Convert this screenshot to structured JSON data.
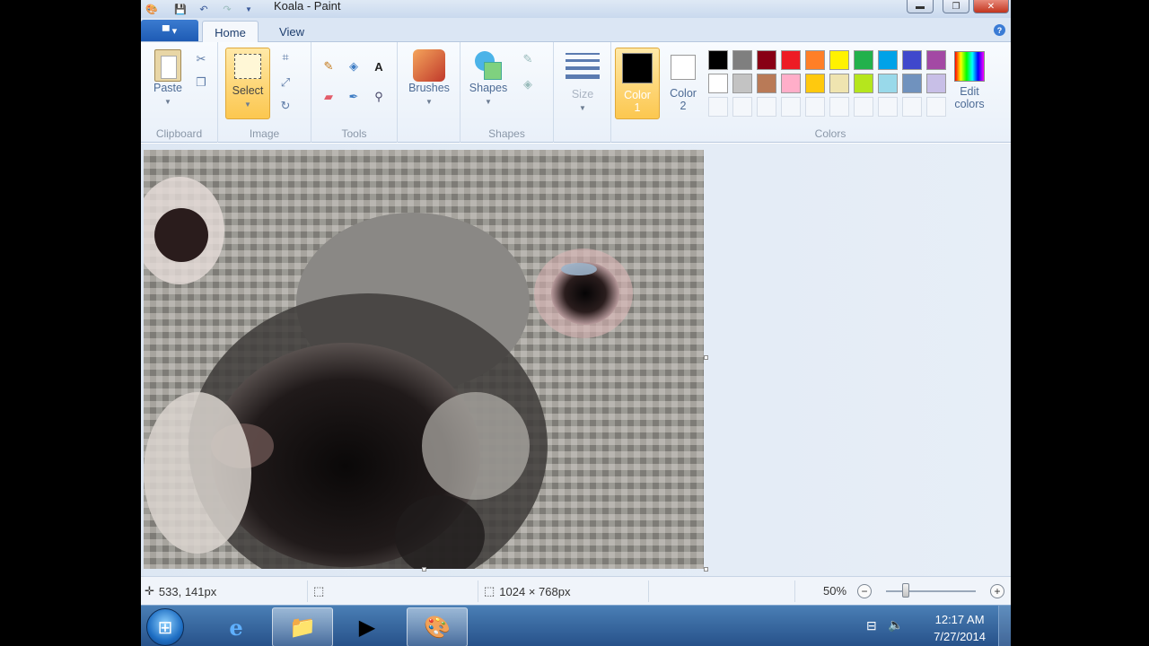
{
  "window": {
    "title": "Koala - Paint",
    "controls": [
      "minimize",
      "maximize",
      "close"
    ]
  },
  "quick_access": [
    "save-icon",
    "undo-icon",
    "redo-icon",
    "customize-icon"
  ],
  "tabs": [
    {
      "label": "Home",
      "active": true
    },
    {
      "label": "View",
      "active": false
    }
  ],
  "ribbon": {
    "groups": {
      "clipboard": {
        "label": "Clipboard",
        "paste": "Paste"
      },
      "image": {
        "label": "Image",
        "select": "Select"
      },
      "tools": {
        "label": "Tools"
      },
      "brushes": {
        "label": "Brushes"
      },
      "shapes": {
        "label": "Shapes",
        "button": "Shapes"
      },
      "size": {
        "label": "Size"
      },
      "color1": {
        "line1": "Color",
        "line2": "1"
      },
      "color2": {
        "line1": "Color",
        "line2": "2"
      },
      "colors": {
        "label": "Colors"
      },
      "edit_colors": {
        "line1": "Edit",
        "line2": "colors"
      }
    },
    "palette_row1": [
      "#000000",
      "#7f7f7f",
      "#880015",
      "#ed1c24",
      "#ff7f27",
      "#fff200",
      "#22b14c",
      "#00a2e8",
      "#3f48cc",
      "#a349a4"
    ],
    "palette_row2": [
      "#ffffff",
      "#c3c3c3",
      "#b97a57",
      "#ffaec9",
      "#ffc90e",
      "#efe4b0",
      "#b5e61d",
      "#99d9ea",
      "#7092be",
      "#c8bfe7"
    ],
    "color1": "#000000",
    "color2": "#ffffff"
  },
  "status": {
    "cursor_pos": "533, 141px",
    "image_size": "1024 × 768px",
    "zoom": "50%",
    "zoom_level_fraction": 0.18
  },
  "taskbar": {
    "apps": [
      "internet-explorer-icon",
      "file-explorer-icon",
      "media-player-icon",
      "paint-icon"
    ],
    "time": "12:17 AM",
    "date": "7/27/2014"
  }
}
